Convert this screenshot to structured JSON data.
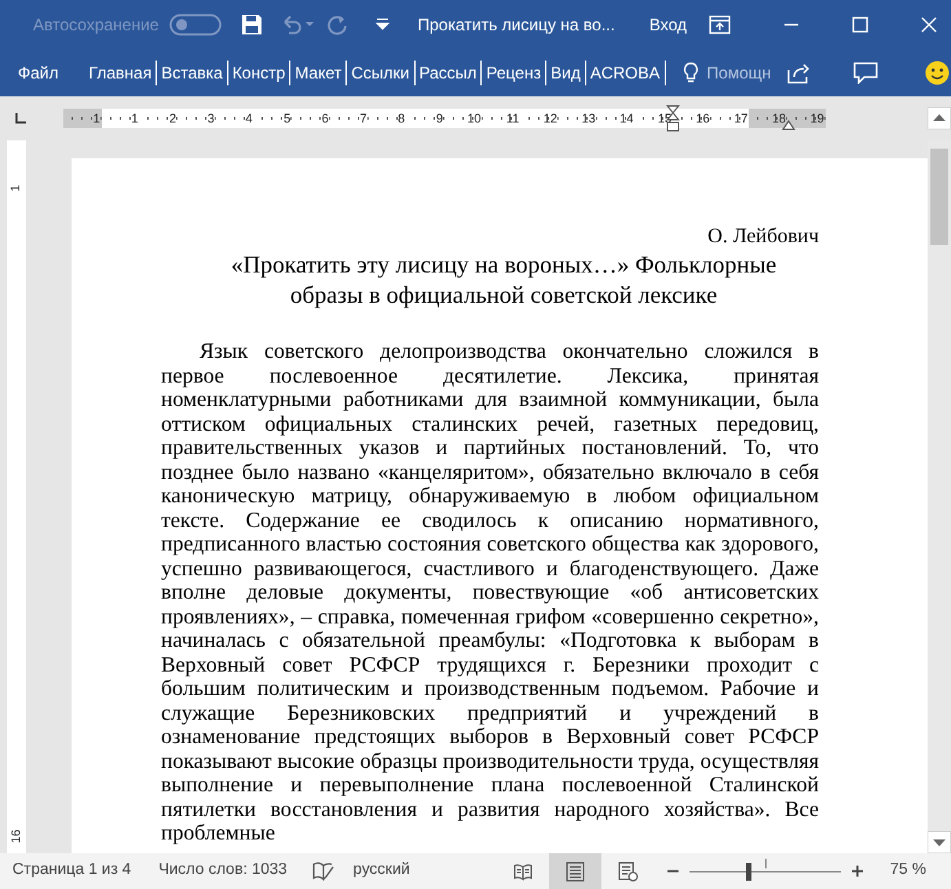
{
  "title_bar": {
    "autosave_label": "Автосохранение",
    "autosave_on": false,
    "document_title": "Прокатить лисицу на во...",
    "sign_in": "Вход"
  },
  "ribbon_tabs": [
    {
      "label": "Файл",
      "selected": false
    },
    {
      "label": "Главная",
      "selected": false
    },
    {
      "label": "Вставка",
      "selected": false
    },
    {
      "label": "Констр",
      "selected": false
    },
    {
      "label": "Макет",
      "selected": false
    },
    {
      "label": "Ссылки",
      "selected": false
    },
    {
      "label": "Рассыл",
      "selected": false
    },
    {
      "label": "Реценз",
      "selected": false
    },
    {
      "label": "Вид",
      "selected": false
    },
    {
      "label": "ACROBA",
      "selected": false
    }
  ],
  "tell_me": {
    "placeholder": "Помощн"
  },
  "ruler": [
    {
      "label": "1",
      "in_margin": true
    },
    {
      "label": "1",
      "in_margin": false
    },
    {
      "label": "2",
      "in_margin": false
    },
    {
      "label": "3",
      "in_margin": false
    },
    {
      "label": "4",
      "in_margin": false
    },
    {
      "label": "5",
      "in_margin": false
    },
    {
      "label": "6",
      "in_margin": false
    },
    {
      "label": "7",
      "in_margin": false
    },
    {
      "label": "8",
      "in_margin": false
    },
    {
      "label": "9",
      "in_margin": false
    },
    {
      "label": "10",
      "in_margin": false
    },
    {
      "label": "11",
      "in_margin": false
    },
    {
      "label": "12",
      "in_margin": false
    },
    {
      "label": "13",
      "in_margin": false
    },
    {
      "label": "14",
      "in_margin": false
    },
    {
      "label": "15",
      "in_margin": false
    },
    {
      "label": "16",
      "in_margin": false
    },
    {
      "label": "17",
      "in_margin": false
    },
    {
      "label": "18",
      "in_margin": true
    },
    {
      "label": "19",
      "in_margin": true
    }
  ],
  "vertical_ruler": [
    "1",
    "16"
  ],
  "document": {
    "author": "О. Лейбович",
    "title": "«Прокатить эту лисицу на вороных…» Фольклорные образы в официальной советской лексике",
    "paragraph": "Язык советского делопроизводства окончательно сложился в первое послевоенное десятилетие. Лексика, принятая номенклатурными работниками для взаимной коммуникации, была оттиском официальных сталинских речей, газетных передовиц, правительственных указов и партийных постановлений. То, что позднее было названо «канцеляритом», обязательно включало в себя каноническую матрицу, обнаруживаемую в любом официальном тексте. Содержание ее сводилось к описанию нормативного, предписанного властью состояния советского общества как здорового, успешно развивающегося, счастливого и благоденствующего. Даже вполне деловые документы, повествующие «об антисоветских проявлениях», – справка, помеченная грифом «совершенно секретно», начиналась с обязательной преамбулы: «Подготовка к выборам в Верховный совет РСФСР трудящихся г. Березники проходит с большим политическим и производственным подъемом. Рабочие и служащие Березниковских предприятий и учреждений в ознаменование предстоящих выборов в Верховный совет РСФСР показывают высокие образцы производительности труда, осуществляя выполнение и перевыполнение плана послевоенной Сталинской пятилетки восстановления и развития народного хозяйства». Все проблемные"
  },
  "status_bar": {
    "page": "Страница 1 из 4",
    "words": "Число слов: 1033",
    "language": "русский",
    "views": [
      {
        "kind": "read",
        "selected": false
      },
      {
        "kind": "print",
        "selected": true
      },
      {
        "kind": "web",
        "selected": false
      }
    ],
    "zoom": {
      "level": 0.39,
      "reading": "75 %"
    }
  }
}
